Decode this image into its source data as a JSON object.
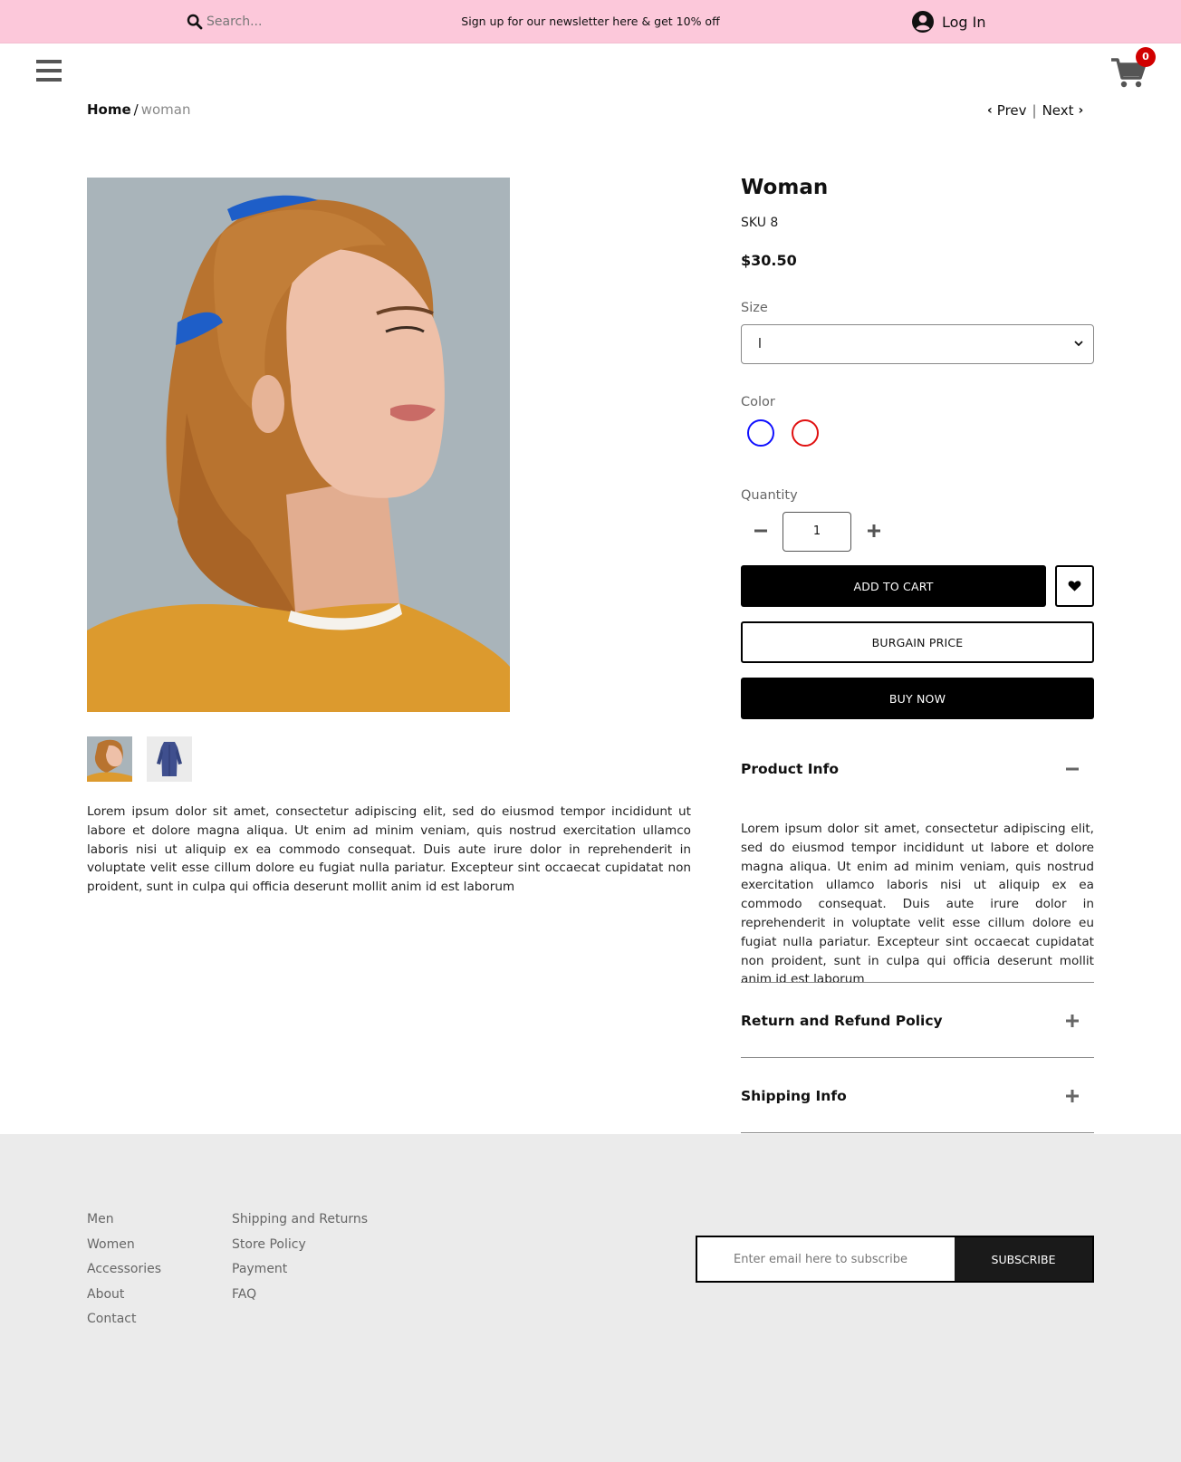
{
  "topbar": {
    "search_placeholder": "Search...",
    "newsletter_text": "Sign up for our newsletter here & get 10% off",
    "login_label": "Log In"
  },
  "header": {
    "cart_count": "0"
  },
  "breadcrumb": {
    "home": "Home",
    "separator": "/",
    "current": "woman"
  },
  "pager": {
    "prev": "Prev",
    "divider": "|",
    "next": "Next"
  },
  "product": {
    "title": "Woman",
    "sku": "SKU 8",
    "price": "$30.50",
    "size_label": "Size",
    "size_value": "l",
    "color_label": "Color",
    "colors": [
      "#1010ff",
      "#e01010"
    ],
    "quantity_label": "Quantity",
    "quantity": "1",
    "add_to_cart": "ADD TO CART",
    "bargain": "BURGAIN PRICE",
    "buy_now": "BUY NOW",
    "description": "Lorem ipsum dolor sit amet, consectetur adipiscing elit, sed do eiusmod tempor incididunt ut labore et dolore magna aliqua. Ut enim ad minim veniam, quis nostrud exercitation ullamco laboris nisi ut aliquip ex ea commodo consequat. Duis aute irure dolor in reprehenderit in voluptate velit esse cillum dolore eu fugiat nulla pariatur. Excepteur sint occaecat cupidatat non proident, sunt in culpa qui officia deserunt mollit anim id est laborum"
  },
  "accordion": [
    {
      "title": "Product Info",
      "icon": "minus-icon",
      "body": "Lorem ipsum dolor sit amet, consectetur adipiscing elit, sed do eiusmod tempor incididunt ut labore et dolore magna aliqua. Ut enim ad minim veniam, quis nostrud exercitation ullamco laboris nisi ut aliquip ex ea commodo consequat. Duis aute irure dolor in reprehenderit in voluptate velit esse cillum dolore eu fugiat nulla pariatur. Excepteur sint occaecat cupidatat non proident, sunt in culpa qui officia deserunt mollit anim id est laborum"
    },
    {
      "title": "Return and Refund Policy",
      "icon": "plus-icon"
    },
    {
      "title": "Shipping Info",
      "icon": "plus-icon"
    }
  ],
  "footer": {
    "col1": [
      "Men",
      "Women",
      "Accessories",
      "About",
      "Contact"
    ],
    "col2": [
      "Shipping and Returns",
      "Store Policy",
      "Payment",
      "FAQ"
    ],
    "subscribe_placeholder": "Enter email here to subscribe",
    "subscribe_button": "SUBSCRIBE"
  },
  "colors": {
    "topbar_bg": "#fcc8da",
    "footer_bg": "#ebebeb",
    "badge": "#d10000"
  }
}
